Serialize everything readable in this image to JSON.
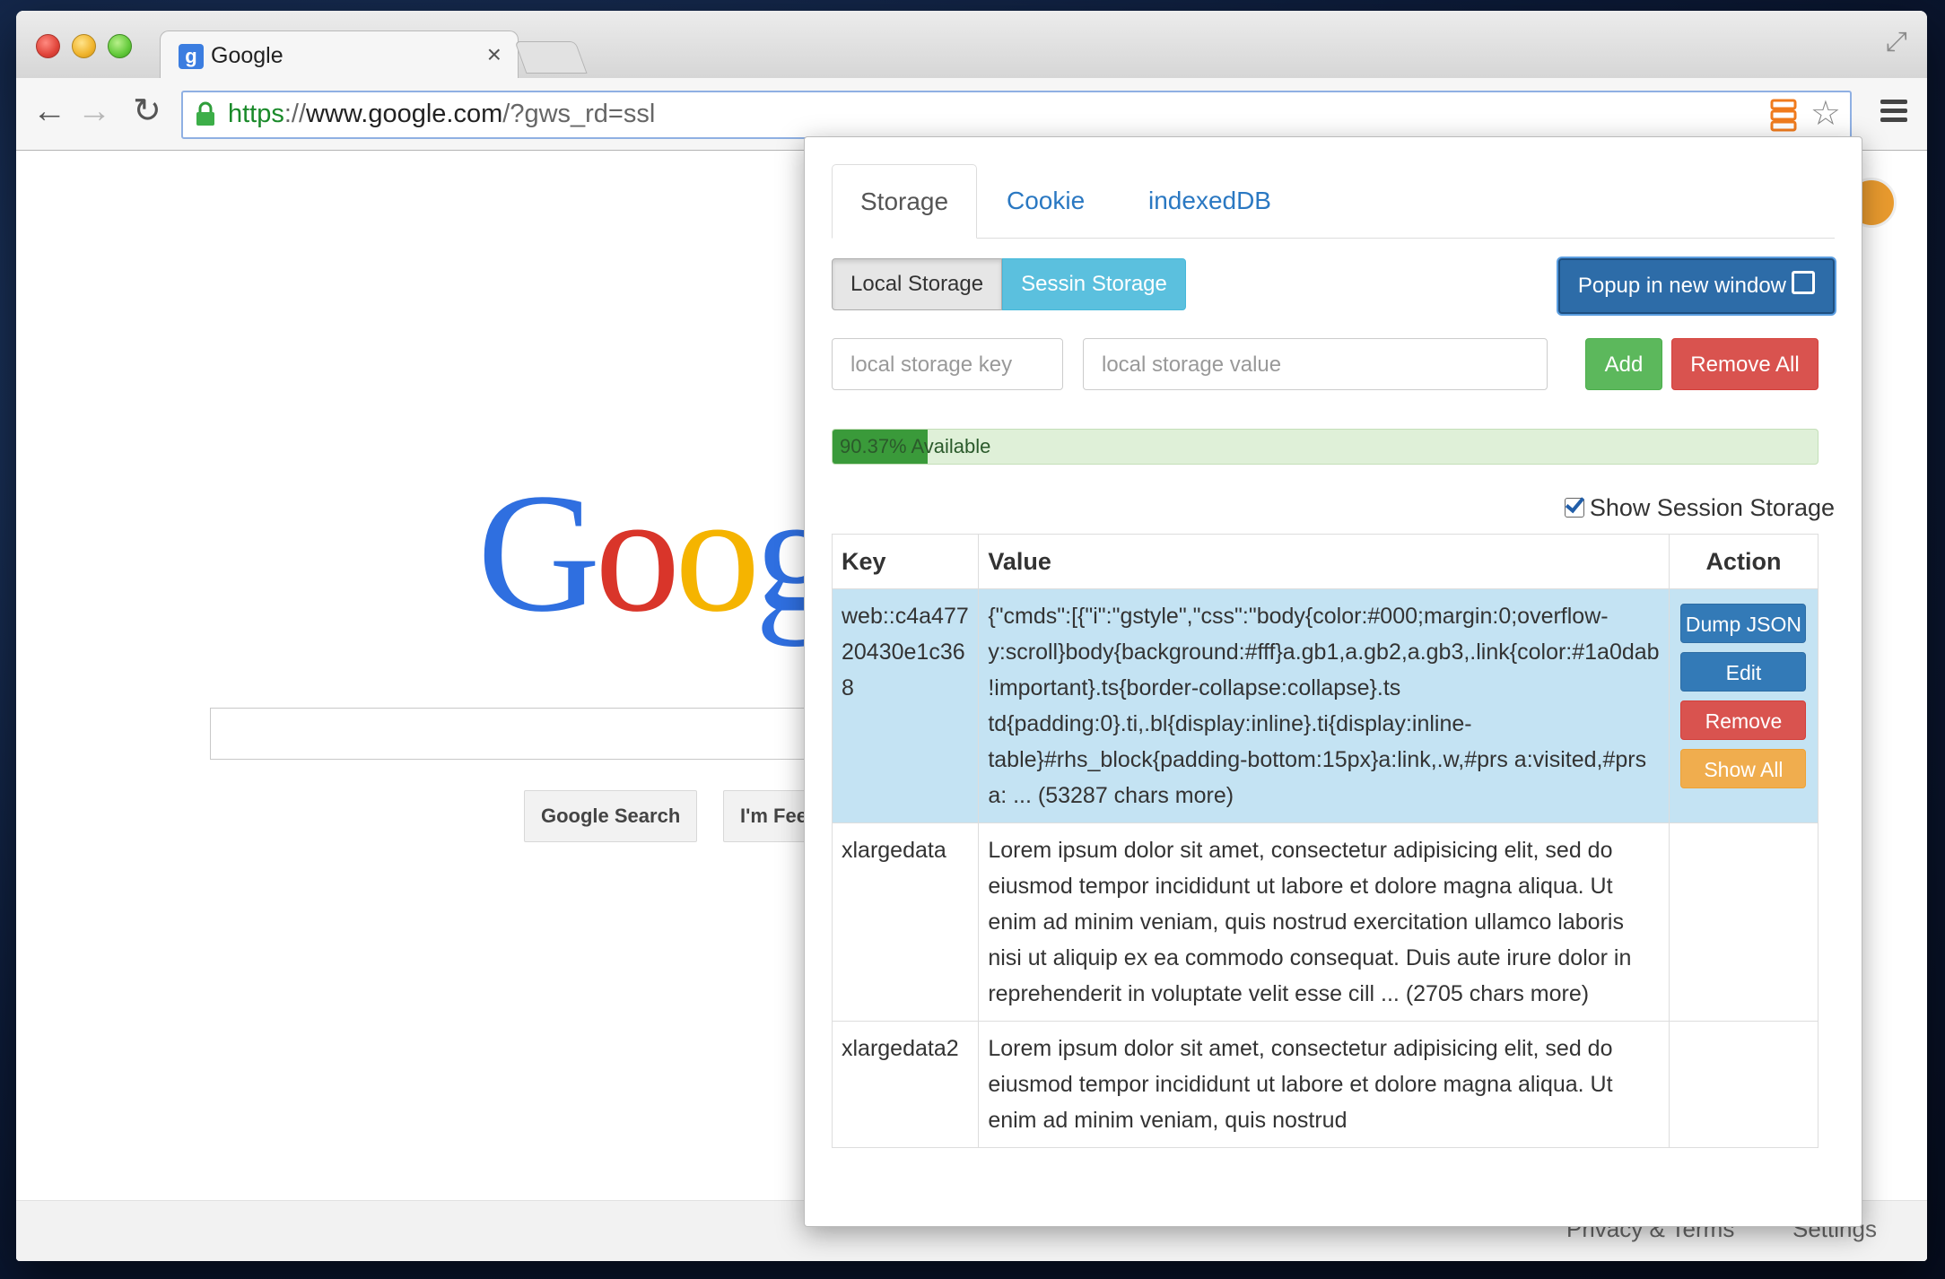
{
  "browser": {
    "tab_title": "Google",
    "favicon_letter": "g",
    "url_scheme": "https",
    "url_sep": "://",
    "url_host": "www.google.com",
    "url_path": "/?gws_rd=ssl"
  },
  "google": {
    "logo": [
      "G",
      "o",
      "o",
      "g"
    ],
    "search_button": "Google Search",
    "lucky_button": "I'm Fee",
    "footer_privacy": "Privacy & Terms",
    "footer_settings": "Settings"
  },
  "popup": {
    "tabs": [
      {
        "label": "Storage"
      },
      {
        "label": "Cookie"
      },
      {
        "label": "indexedDB"
      }
    ],
    "local_storage_label": "Local Storage",
    "session_storage_label": "Sessin Storage",
    "popup_window_label": "Popup in new window",
    "key_placeholder": "local storage key",
    "value_placeholder": "local storage value",
    "add_label": "Add",
    "remove_all_label": "Remove All",
    "available_percent": 90.37,
    "used_fraction": 0.0963,
    "available_label": "90.37% Available",
    "show_session_label": "Show Session Storage",
    "show_session_checked": true,
    "table": {
      "headers": [
        "Key",
        "Value",
        "Action"
      ],
      "rows": [
        {
          "key": "web::c4a47720430e1c368",
          "value": "{\"cmds\":[{\"i\":\"gstyle\",\"css\":\"body{color:#000;margin:0;overflow-y:scroll}body{background:#fff}a.gb1,a.gb2,a.gb3,.link{color:#1a0dab !important}.ts{border-collapse:collapse}.ts td{padding:0}.ti,.bl{display:inline}.ti{display:inline-table}#rhs_block{padding-bottom:15px}a:link,.w,#prs a:visited,#prs a: ... (53287 chars more)",
          "actions": [
            "Dump JSON",
            "Edit",
            "Remove",
            "Show All"
          ]
        },
        {
          "key": "xlargedata",
          "value": "Lorem ipsum dolor sit amet, consectetur adipisicing elit, sed do eiusmod tempor incididunt ut labore et dolore magna aliqua. Ut enim ad minim veniam, quis nostrud exercitation ullamco laboris nisi ut aliquip ex ea commodo consequat. Duis aute irure dolor in reprehenderit in voluptate velit esse cill ... (2705 chars more)",
          "actions": []
        },
        {
          "key": "xlargedata2",
          "value": "Lorem ipsum dolor sit amet, consectetur adipisicing elit, sed do eiusmod tempor incididunt ut labore et dolore magna aliqua. Ut enim ad minim veniam, quis nostrud",
          "actions": []
        }
      ]
    }
  },
  "colors": {
    "primary": "#337ab7",
    "info": "#5bc0de",
    "success": "#5cb85c",
    "danger": "#d9534f",
    "warning": "#f0ad4e",
    "row_highlight": "#c4e3f3"
  },
  "icons": {
    "back": "back-arrow-icon",
    "forward": "forward-arrow-icon",
    "reload": "reload-icon",
    "lock": "lock-icon",
    "extension": "storage-extension-icon",
    "bookmark": "star-icon",
    "menu": "hamburger-menu-icon",
    "external": "external-link-icon"
  }
}
